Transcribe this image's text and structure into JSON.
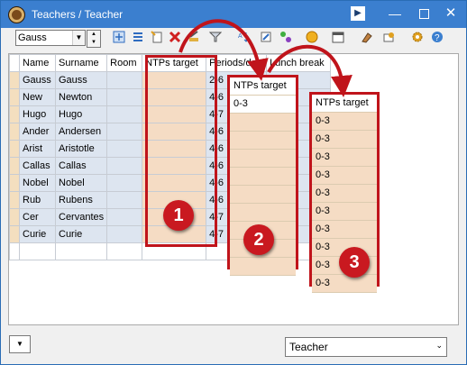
{
  "window": {
    "title": "Teachers / Teacher"
  },
  "toolbar": {
    "teacher_select_value": "Gauss"
  },
  "grid": {
    "columns": [
      "Name",
      "Surname",
      "Room",
      "NTPs target",
      "Periods/day",
      "Lunch break"
    ],
    "rows": [
      {
        "name": "Gauss",
        "surname": "Gauss",
        "room": "",
        "periods": "2-6"
      },
      {
        "name": "New",
        "surname": "Newton",
        "room": "",
        "periods": "4-6"
      },
      {
        "name": "Hugo",
        "surname": "Hugo",
        "room": "",
        "periods": "4-7"
      },
      {
        "name": "Ander",
        "surname": "Andersen",
        "room": "",
        "periods": "4-6"
      },
      {
        "name": "Arist",
        "surname": "Aristotle",
        "room": "",
        "periods": "4-6"
      },
      {
        "name": "Callas",
        "surname": "Callas",
        "room": "",
        "periods": "4-6"
      },
      {
        "name": "Nobel",
        "surname": "Nobel",
        "room": "",
        "periods": "4-6"
      },
      {
        "name": "Rub",
        "surname": "Rubens",
        "room": "",
        "periods": "4-6"
      },
      {
        "name": "Cer",
        "surname": "Cervantes",
        "room": "",
        "periods": "4-7"
      },
      {
        "name": "Curie",
        "surname": "Curie",
        "room": "",
        "periods": "4-7"
      }
    ]
  },
  "step2": {
    "header": "NTPs target",
    "value": "0-3"
  },
  "step3": {
    "header": "NTPs target",
    "values": [
      "0-3",
      "0-3",
      "0-3",
      "0-3",
      "0-3",
      "0-3",
      "0-3",
      "0-3",
      "0-3",
      "0-3"
    ]
  },
  "badges": [
    "1",
    "2",
    "3"
  ],
  "bottom": {
    "element_select_value": "Teacher"
  },
  "colors": {
    "title_bar": "#3b7fcf",
    "annotation_red": "#c0141b",
    "row_fill": "#dde5f0",
    "highlight_fill": "#f5dcc4"
  }
}
